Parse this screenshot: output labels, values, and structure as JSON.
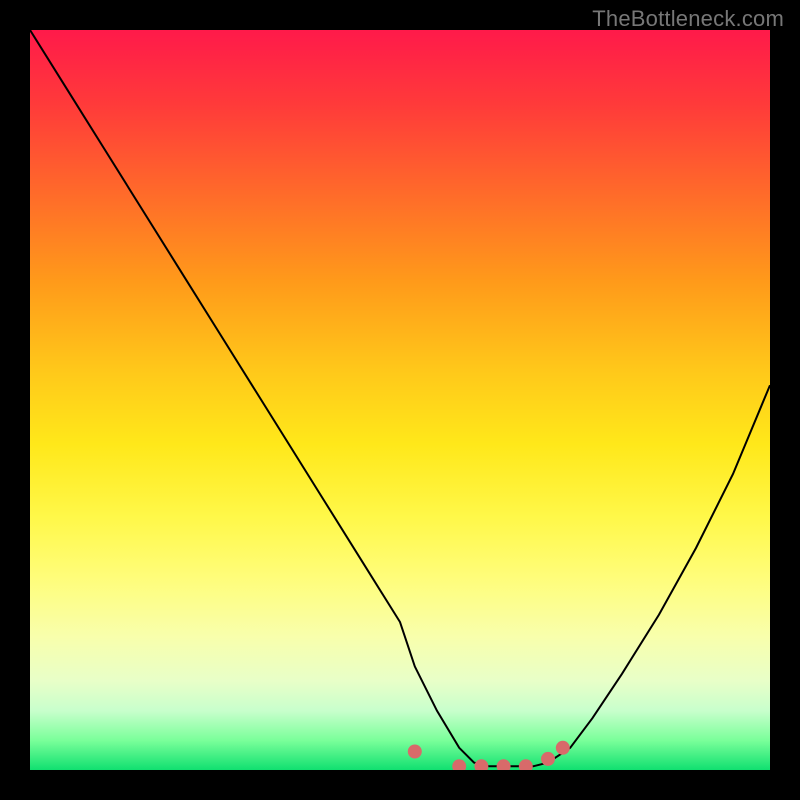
{
  "watermark": "TheBottleneck.com",
  "colors": {
    "background": "#000000",
    "curve": "#000000",
    "marker": "#d86a6a",
    "gradient_top": "#ff1a4a",
    "gradient_bottom": "#10e070"
  },
  "chart_data": {
    "type": "line",
    "title": "",
    "xlabel": "",
    "ylabel": "",
    "xlim": [
      0,
      100
    ],
    "ylim": [
      0,
      100
    ],
    "series": [
      {
        "name": "bottleneck-curve",
        "x": [
          0,
          5,
          10,
          15,
          20,
          25,
          30,
          35,
          40,
          45,
          50,
          52,
          55,
          58,
          60,
          62,
          65,
          68,
          70,
          73,
          76,
          80,
          85,
          90,
          95,
          100
        ],
        "values": [
          100,
          92,
          84,
          76,
          68,
          60,
          52,
          44,
          36,
          28,
          20,
          14,
          8,
          3,
          1,
          0.5,
          0.5,
          0.5,
          1,
          3,
          7,
          13,
          21,
          30,
          40,
          52
        ]
      }
    ],
    "markers": [
      {
        "name": "left-edge-dot",
        "x": 52,
        "y": 2.5
      },
      {
        "name": "bottom-dot-1",
        "x": 58,
        "y": 0.5
      },
      {
        "name": "bottom-dot-2",
        "x": 61,
        "y": 0.5
      },
      {
        "name": "bottom-dot-3",
        "x": 64,
        "y": 0.5
      },
      {
        "name": "bottom-dot-4",
        "x": 67,
        "y": 0.5
      },
      {
        "name": "right-edge-dot-1",
        "x": 70,
        "y": 1.5
      },
      {
        "name": "right-edge-dot-2",
        "x": 72,
        "y": 3.0
      }
    ]
  }
}
